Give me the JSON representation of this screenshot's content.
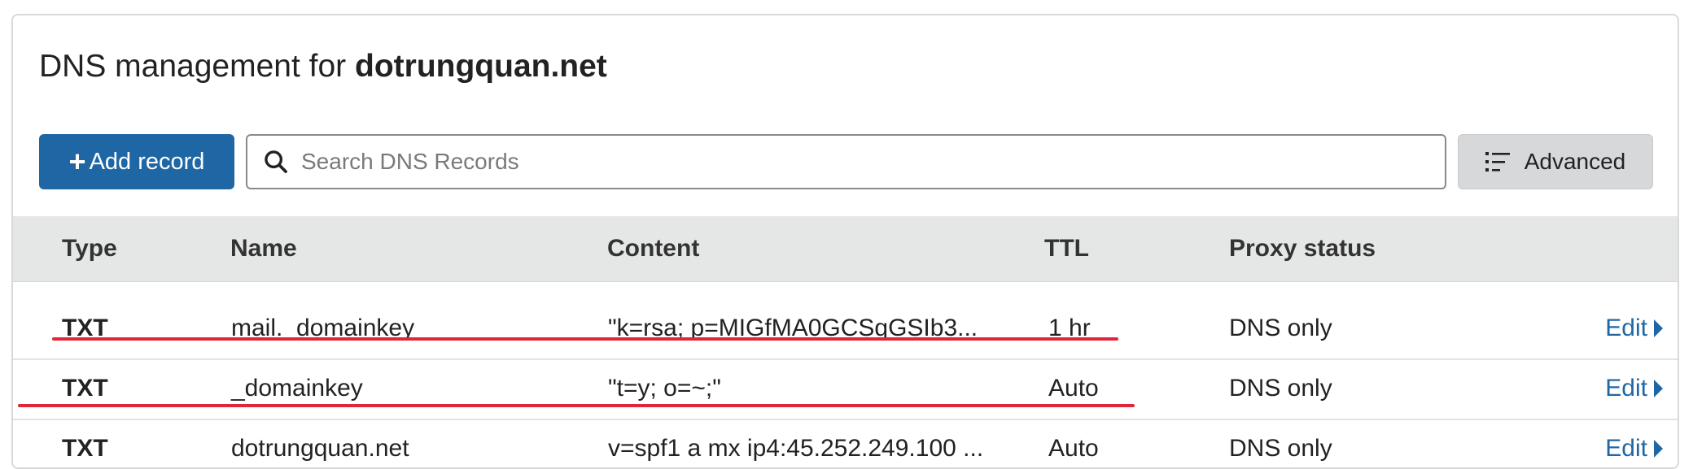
{
  "header": {
    "title_prefix": "DNS management for",
    "domain": "dotrungquan.net"
  },
  "toolbar": {
    "add_icon": "+",
    "add_label": "Add record",
    "search_placeholder": "Search DNS Records",
    "advanced_label": "Advanced",
    "icons": {
      "search": "search-icon",
      "advanced": "list-filter-icon",
      "add": "plus-icon"
    }
  },
  "table": {
    "columns": [
      "Type",
      "Name",
      "Content",
      "TTL",
      "Proxy status"
    ],
    "rows": [
      {
        "type": "TXT",
        "name": "mail._domainkey",
        "content": "\"k=rsa; p=MIGfMA0GCSqGSIb3...",
        "ttl": "1 hr",
        "proxy": "DNS only",
        "edit": "Edit"
      },
      {
        "type": "TXT",
        "name": "_domainkey",
        "content": "\"t=y; o=~;\"",
        "ttl": "Auto",
        "proxy": "DNS only",
        "edit": "Edit"
      },
      {
        "type": "TXT",
        "name": "dotrungquan.net",
        "content": "v=spf1 a mx ip4:45.252.249.100 ...",
        "ttl": "Auto",
        "proxy": "DNS only",
        "edit": "Edit"
      }
    ]
  },
  "colors": {
    "primary": "#1f67a4",
    "annotation_underline": "#e2253b",
    "header_bg": "#e5e6e6",
    "advanced_bg": "#d6d8d9"
  }
}
